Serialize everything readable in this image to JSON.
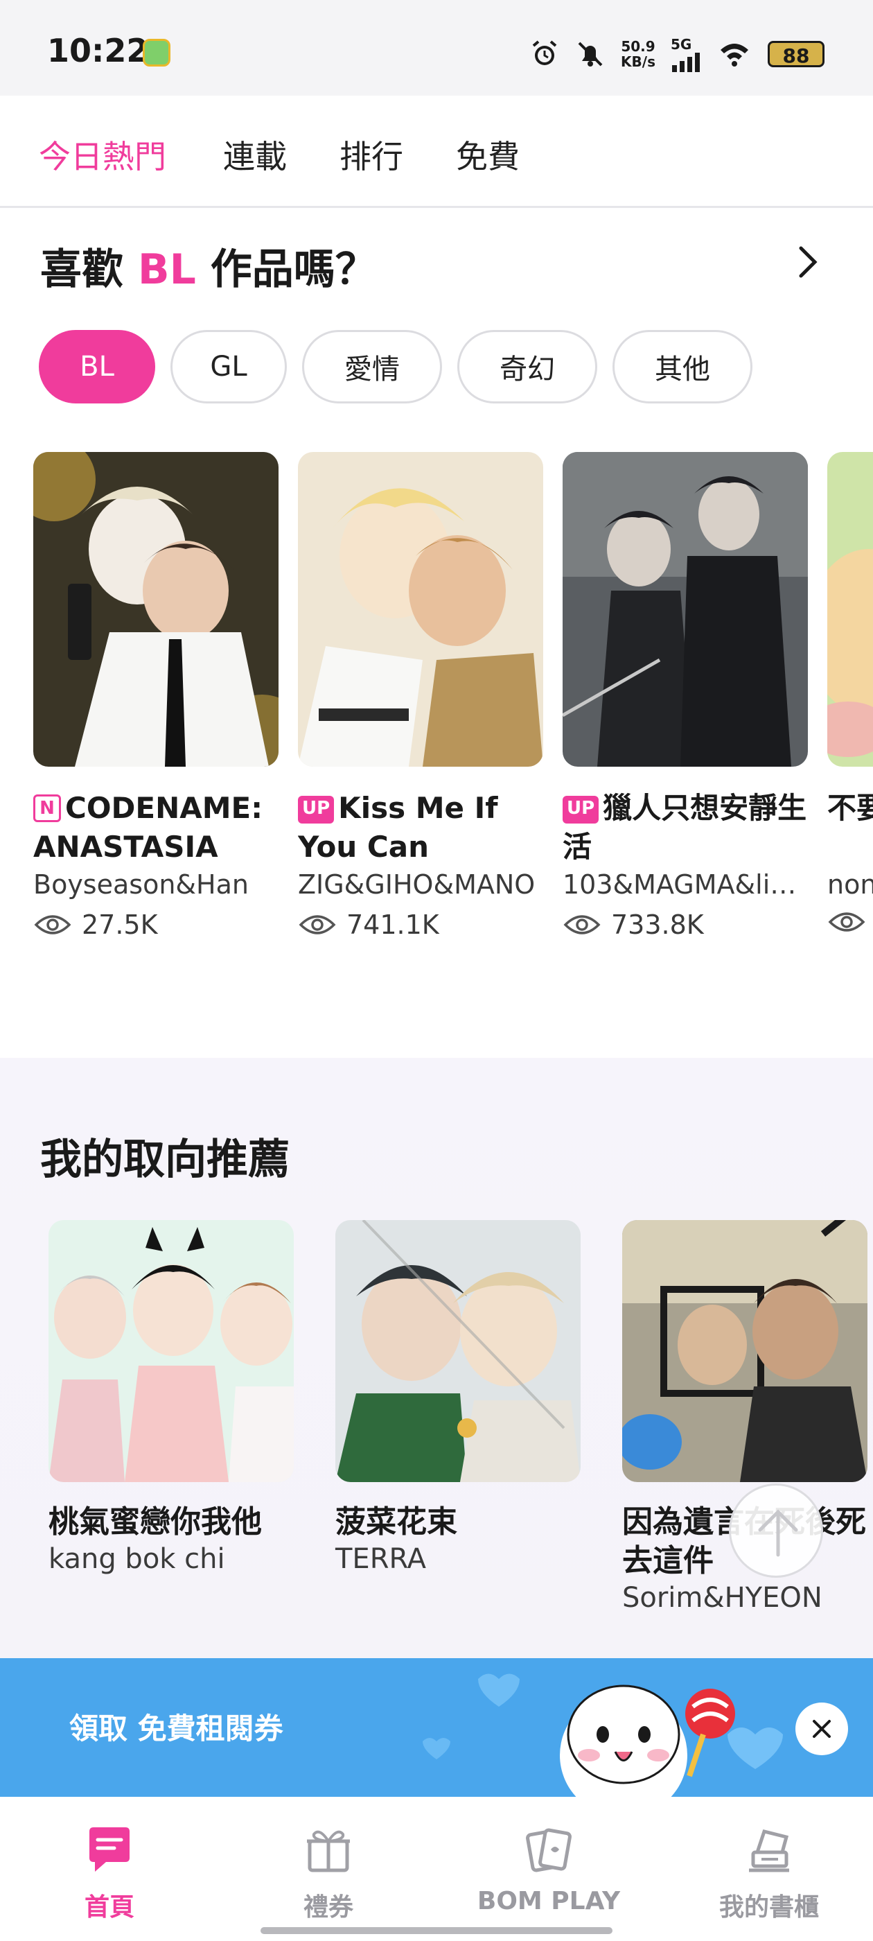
{
  "status_bar": {
    "time": "10:22",
    "net_speed_value": "50.9",
    "net_speed_unit": "KB/s",
    "network": "5G",
    "battery": "88",
    "icons": [
      "app-notification-icon",
      "alarm-icon",
      "mute-icon",
      "signal-icon",
      "wifi-icon",
      "battery-icon"
    ]
  },
  "top_tabs": [
    {
      "label": "今日熱門",
      "active": true
    },
    {
      "label": "連載",
      "active": false
    },
    {
      "label": "排行",
      "active": false
    },
    {
      "label": "免費",
      "active": false
    }
  ],
  "genre_section": {
    "title_prefix": "喜歡 ",
    "title_highlight": "BL",
    "title_suffix": " 作品嗎？",
    "more_icon": "chevron-right-icon",
    "chips": [
      {
        "label": "BL",
        "active": true
      },
      {
        "label": "GL",
        "active": false
      },
      {
        "label": "愛情",
        "active": false
      },
      {
        "label": "奇幻",
        "active": false
      },
      {
        "label": "其他",
        "active": false
      }
    ],
    "cards": [
      {
        "badge": "N",
        "title": "CODENAME: ANASTASIA 代…",
        "author": "Boyseason&Han",
        "views": "27.5K"
      },
      {
        "badge": "UP",
        "title": "Kiss Me If You Can",
        "author": "ZIG&GIHO&MANO",
        "views": "741.1K"
      },
      {
        "badge": "UP",
        "title": "獵人只想安靜生活",
        "author": "103&MAGMA&ligo…",
        "views": "733.8K"
      },
      {
        "badge": "",
        "title": "不要",
        "author": "non",
        "views": ""
      }
    ]
  },
  "recommend_section": {
    "title": "我的取向推薦",
    "items": [
      {
        "title": "桃氣蜜戀你我他",
        "author": "kang bok chi"
      },
      {
        "title": "菠菜花束",
        "author": "TERRA"
      },
      {
        "title": "因為遺言在死後死去這件",
        "author": "Sorim&HYEON"
      }
    ]
  },
  "banner": {
    "text": "領取 免費租閱券",
    "close_icon": "close-icon"
  },
  "bottom_nav": [
    {
      "label": "首頁",
      "icon": "home-chat-icon",
      "active": true
    },
    {
      "label": "禮券",
      "icon": "gift-icon",
      "active": false
    },
    {
      "label": "BOM PLAY",
      "icon": "cards-icon",
      "active": false
    },
    {
      "label": "我的書櫃",
      "icon": "bookshelf-icon",
      "active": false
    }
  ],
  "colors": {
    "accent": "#f03c9c",
    "banner": "#4aa6ec",
    "text": "#1a1a1a",
    "muted": "#9a9aa0"
  }
}
